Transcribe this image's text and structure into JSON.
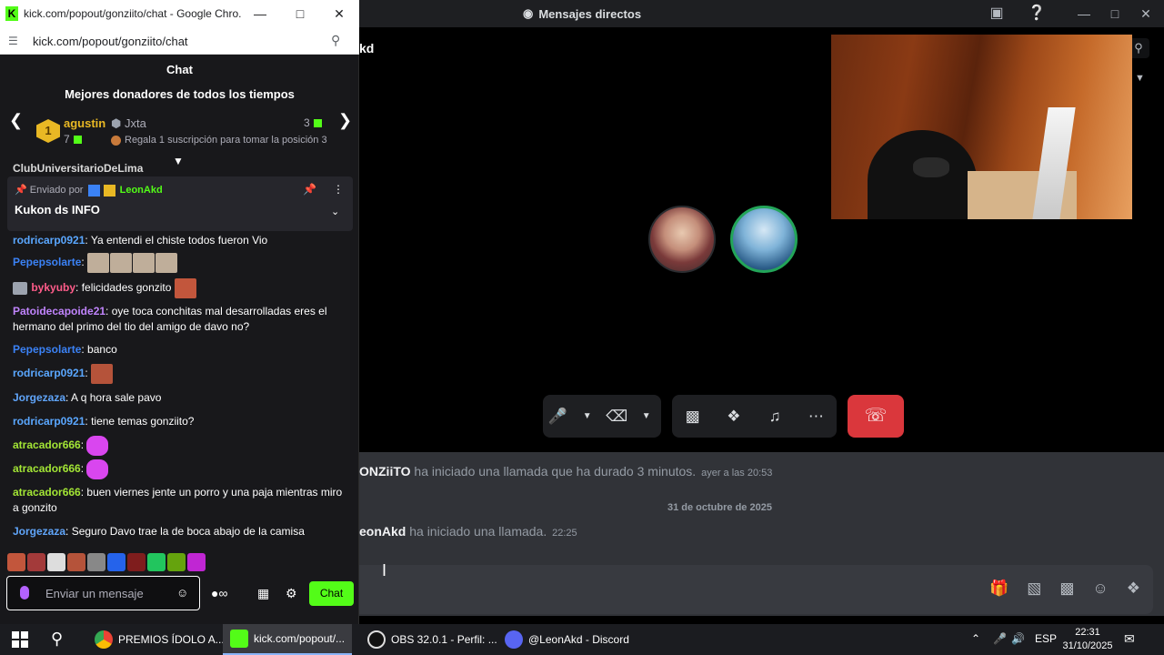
{
  "discord": {
    "window_title": "Mensajes directos",
    "channel_name": "kd",
    "call_log": [
      {
        "user": "ONZiiTO",
        "text": "ha iniciado una llamada que ha durado 3 minutos.",
        "time": "ayer a las 20:53"
      },
      {
        "user": "eonAkd",
        "text": "ha iniciado una llamada.",
        "time": "22:25"
      }
    ],
    "date_divider": "31 de octubre de 2025",
    "hangup_color": "#da373c",
    "speaking_color": "#23a559"
  },
  "chrome": {
    "title": "kick.com/popout/gonziito/chat - Google Chro...",
    "url": "kick.com/popout/gonziito/chat"
  },
  "kick": {
    "header": "Chat",
    "donors_title": "Mejores donadores de todos los tiempos",
    "donor1": {
      "rank": "1",
      "name": "agustin",
      "count": "7"
    },
    "donor2": {
      "name": "Jxta",
      "count": "3"
    },
    "donor_hint": "Regala 1 suscripción para tomar la posición 3",
    "cutoff_user": "ClubUniversitarioDeLima",
    "pinned": {
      "label_prefix": "Enviado por",
      "user": "LeonAkd",
      "text": "Kukon ds INFO"
    },
    "messages": [
      {
        "user": "rodricarp0921",
        "color": "#5aa7ff",
        "text": "Ya entendi el chiste todos fueron Vio"
      },
      {
        "user": "Pepepsolarte",
        "color": "#3b82f6",
        "text": ""
      },
      {
        "user": "bykyuby",
        "color": "#ff5c8a",
        "text": "felicidades gonzito"
      },
      {
        "user": "Patoidecapoide21",
        "color": "#c084fc",
        "text": "oye toca conchitas mal desarrolladas eres el hermano del primo del tio del amigo de davo no?"
      },
      {
        "user": "Pepepsolarte",
        "color": "#3b82f6",
        "text": "banco"
      },
      {
        "user": "rodricarp0921",
        "color": "#5aa7ff",
        "text": ""
      },
      {
        "user": "Jorgezaza",
        "color": "#60a5fa",
        "text": "A q hora sale pavo"
      },
      {
        "user": "rodricarp0921",
        "color": "#5aa7ff",
        "text": "tiene temas gonziito?"
      },
      {
        "user": "atracador666",
        "color": "#a3e635",
        "text": ""
      },
      {
        "user": "atracador666",
        "color": "#a3e635",
        "text": ""
      },
      {
        "user": "atracador666",
        "color": "#a3e635",
        "text": "buen viernes jente un porro y una paja mientras miro a gonzito"
      },
      {
        "user": "Jorgezaza",
        "color": "#60a5fa",
        "text": "Seguro Davo trae la de boca abajo de la camisa"
      }
    ],
    "input_placeholder": "Enviar un mensaje",
    "send_label": "Chat",
    "accent": "#53fc18"
  },
  "taskbar": {
    "items": [
      {
        "label": "PREMIOS ÍDOLO A...",
        "icon": "chrome-icon"
      },
      {
        "label": "kick.com/popout/...",
        "icon": "kick-icon"
      },
      {
        "label": "OBS 32.0.1 - Perfil: ...",
        "icon": "obs-icon"
      },
      {
        "label": "@LeonAkd - Discord",
        "icon": "discord-icon"
      }
    ],
    "lang": "ESP",
    "time": "22:31",
    "date": "31/10/2025"
  }
}
